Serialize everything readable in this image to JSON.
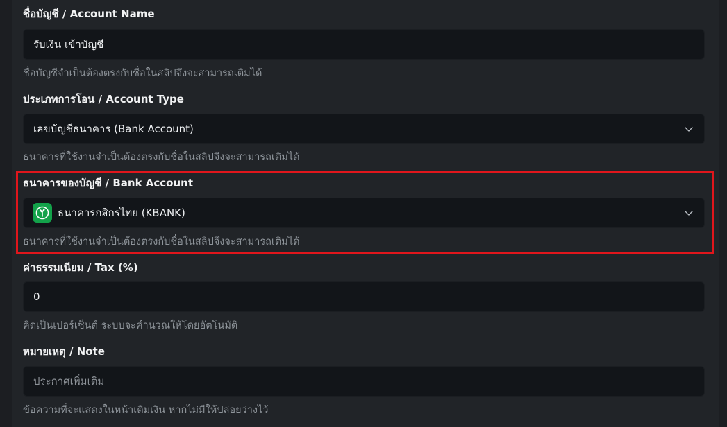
{
  "account_name": {
    "label": "ชื่อบัญชี / Account Name",
    "value": "รับเงิน เข้าบัญชี",
    "help": "ชื่อบัญชีจำเป็นต้องตรงกับชื่อในสลิปจึงจะสามารถเติมได้"
  },
  "account_type": {
    "label": "ประเภทการโอน / Account Type",
    "value": "เลขบัญชีธนาคาร (Bank Account)",
    "help": "ธนาคารที่ใช้งานจำเป็นต้องตรงกับชื่อในสลิปจึงจะสามารถเติมได้"
  },
  "bank_account": {
    "label": "ธนาคารของบัญชี / Bank Account",
    "value": "ธนาคารกสิกรไทย (KBANK)",
    "icon": "kbank-logo-icon",
    "help": "ธนาคารที่ใช้งานจำเป็นต้องตรงกับชื่อในสลิปจึงจะสามารถเติมได้"
  },
  "tax": {
    "label": "ค่าธรรมเนียม / Tax (%)",
    "value": "0",
    "help": "คิดเป็นเปอร์เซ็นต์ ระบบจะคำนวณให้โดยอัตโนมัติ"
  },
  "note": {
    "label": "หมายเหตุ / Note",
    "placeholder": "ประกาศเพิ่มเติม",
    "help": "ข้อความที่จะแสดงในหน้าเติมเงิน หากไม่มีให้ปล่อยว่างไว้"
  },
  "colors": {
    "highlight": "#e0161c",
    "kbank_green": "#13a24a"
  }
}
